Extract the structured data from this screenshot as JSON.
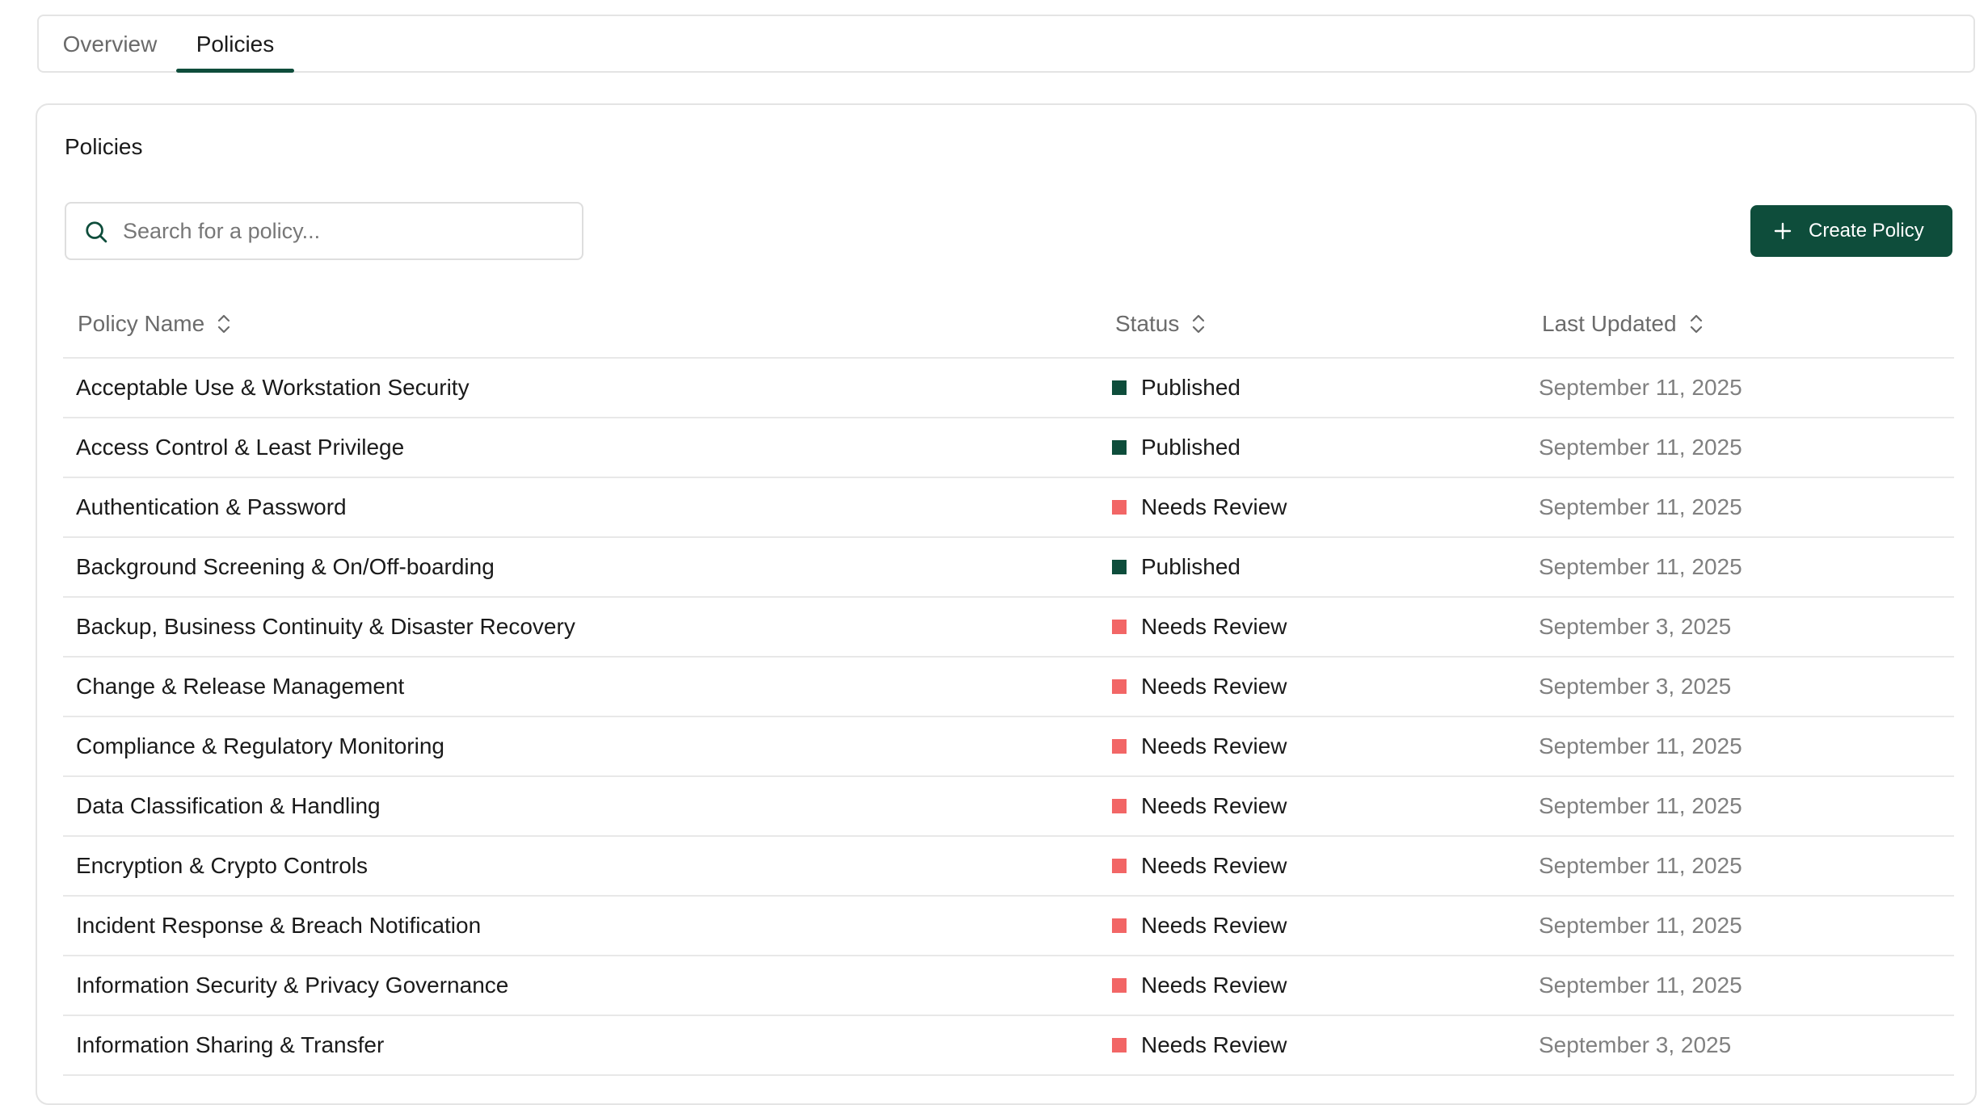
{
  "tabs": [
    {
      "label": "Overview",
      "active": false
    },
    {
      "label": "Policies",
      "active": true
    }
  ],
  "accent_color": "#0e4d3b",
  "status_colors": {
    "Published": "#0e4d3b",
    "Needs Review": "#f26666"
  },
  "card": {
    "title": "Policies"
  },
  "search": {
    "placeholder": "Search for a policy...",
    "value": "",
    "icon": "search-icon"
  },
  "create_button": {
    "label": "Create Policy",
    "icon": "plus-icon"
  },
  "table": {
    "columns": [
      {
        "label": "Policy Name",
        "sortable": true
      },
      {
        "label": "Status",
        "sortable": true
      },
      {
        "label": "Last Updated",
        "sortable": true
      }
    ],
    "rows": [
      {
        "name": "Acceptable Use & Workstation Security",
        "status": "Published",
        "updated": "September 11, 2025"
      },
      {
        "name": "Access Control & Least Privilege",
        "status": "Published",
        "updated": "September 11, 2025"
      },
      {
        "name": "Authentication & Password",
        "status": "Needs Review",
        "updated": "September 11, 2025"
      },
      {
        "name": "Background Screening & On/Off-boarding",
        "status": "Published",
        "updated": "September 11, 2025"
      },
      {
        "name": "Backup, Business Continuity & Disaster Recovery",
        "status": "Needs Review",
        "updated": "September 3, 2025"
      },
      {
        "name": "Change & Release Management",
        "status": "Needs Review",
        "updated": "September 3, 2025"
      },
      {
        "name": "Compliance & Regulatory Monitoring",
        "status": "Needs Review",
        "updated": "September 11, 2025"
      },
      {
        "name": "Data Classification & Handling",
        "status": "Needs Review",
        "updated": "September 11, 2025"
      },
      {
        "name": "Encryption & Crypto Controls",
        "status": "Needs Review",
        "updated": "September 11, 2025"
      },
      {
        "name": "Incident Response & Breach Notification",
        "status": "Needs Review",
        "updated": "September 11, 2025"
      },
      {
        "name": "Information Security & Privacy Governance",
        "status": "Needs Review",
        "updated": "September 11, 2025"
      },
      {
        "name": "Information Sharing & Transfer",
        "status": "Needs Review",
        "updated": "September 3, 2025"
      }
    ]
  }
}
